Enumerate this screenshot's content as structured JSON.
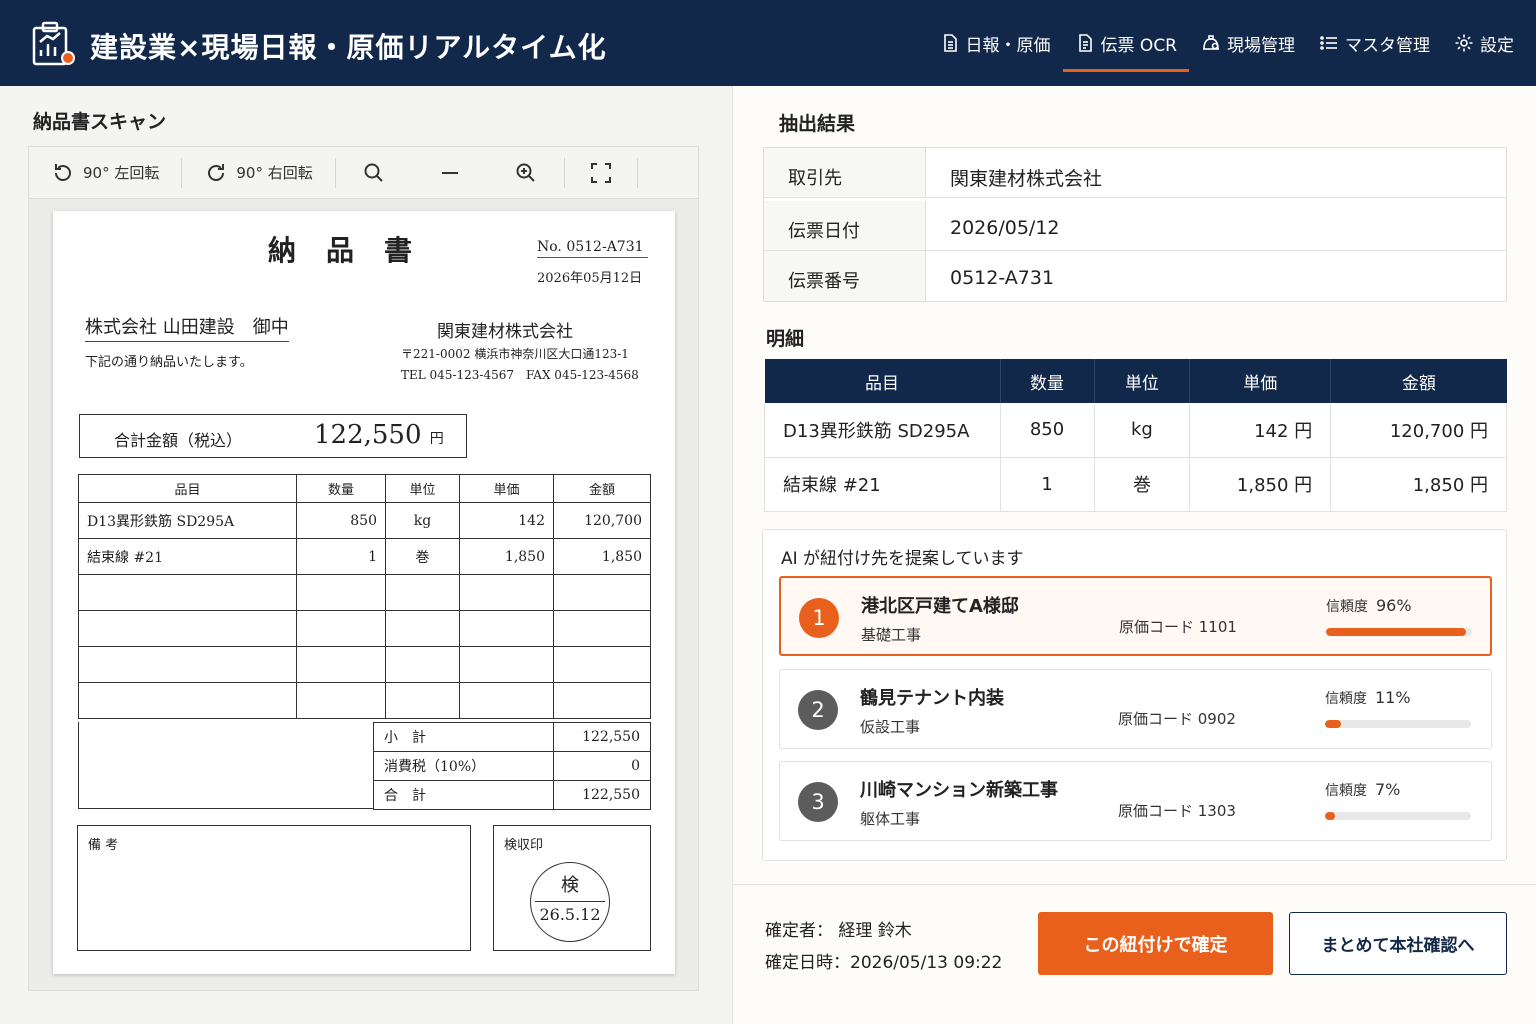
{
  "app": {
    "title": "建設業×現場日報・原価リアルタイム化",
    "accent": "#e8601c",
    "navy": "#12284a"
  },
  "nav": [
    {
      "label": "日報・原価",
      "icon": "document-icon"
    },
    {
      "label": "伝票 OCR",
      "icon": "receipt-icon",
      "active": true
    },
    {
      "label": "現場管理",
      "icon": "site-icon"
    },
    {
      "label": "マスタ管理",
      "icon": "list-icon"
    },
    {
      "label": "設定",
      "icon": "gear-icon"
    }
  ],
  "scan": {
    "title": "納品書スキャン",
    "toolbar": {
      "rotate_left": "90° 左回転",
      "rotate_right": "90° 右回転"
    },
    "doc": {
      "title": "納品書",
      "no": "No. 0512-A731",
      "date": "2026年05月12日",
      "customer": "株式会社 山田建設　御中",
      "greeting": "下記の通り納品いたします。",
      "supplier": "関東建材株式会社",
      "address": "〒221-0002 横浜市神奈川区大口通123-1",
      "tel": "TEL 045-123-4567　FAX 045-123-4568",
      "total_label": "合計金額（税込）",
      "total_value": "122,550",
      "total_unit": "円",
      "headers": [
        "品目",
        "数量",
        "単位",
        "単価",
        "金額"
      ],
      "rows": [
        [
          "D13異形鉄筋 SD295A",
          "850",
          "kg",
          "142",
          "120,700"
        ],
        [
          "結束線 #21",
          "1",
          "巻",
          "1,850",
          "1,850"
        ]
      ],
      "subtotal_label": "小　計",
      "subtotal": "122,550",
      "tax_label": "消費税（10%）",
      "tax": "0",
      "grand_label": "合　計",
      "grand": "122,550",
      "remarks_label": "備 考",
      "stamp_label": "検収印",
      "stamp_top": "検",
      "stamp_date": "26.5.12"
    }
  },
  "result": {
    "title": "抽出結果",
    "fields": [
      {
        "key": "取引先",
        "value": "関東建材株式会社"
      },
      {
        "key": "伝票日付",
        "value": "2026/05/12"
      },
      {
        "key": "伝票番号",
        "value": "0512-A731"
      }
    ],
    "detail_title": "明細",
    "headers": [
      "品目",
      "数量",
      "単位",
      "単価",
      "金額"
    ],
    "rows": [
      [
        "D13異形鉄筋 SD295A",
        "850",
        "kg",
        "142 円",
        "120,700 円"
      ],
      [
        "結束線 #21",
        "1",
        "巻",
        "1,850 円",
        "1,850 円"
      ]
    ]
  },
  "ai": {
    "title": "AI が紐付け先を提案しています",
    "conf_label": "信頼度",
    "suggestions": [
      {
        "rank": "1",
        "name": "港北区戸建てA様邸",
        "sub": "基礎工事",
        "code": "原価コード 1101",
        "conf": "96%",
        "conf_value": 96
      },
      {
        "rank": "2",
        "name": "鶴見テナント内装",
        "sub": "仮設工事",
        "code": "原価コード 0902",
        "conf": "11%",
        "conf_value": 11
      },
      {
        "rank": "3",
        "name": "川崎マンション新築工事",
        "sub": "躯体工事",
        "code": "原価コード 1303",
        "conf": "7%",
        "conf_value": 7
      }
    ]
  },
  "footer": {
    "approver": "確定者：  経理 鈴木",
    "approved_at": "確定日時：2026/05/13 09:22",
    "confirm_button": "この紐付けで確定",
    "batch_button": "まとめて本社確認へ"
  }
}
